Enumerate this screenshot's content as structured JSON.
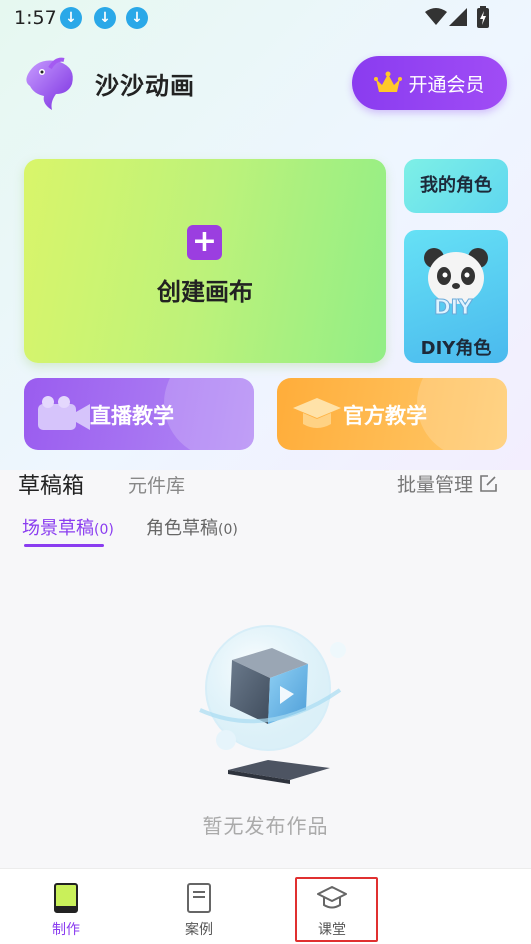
{
  "status_bar": {
    "time": "1:57",
    "notification_icons": [
      "download-icon",
      "download-icon",
      "download-icon"
    ],
    "system_icons": [
      "wifi-icon",
      "signal-icon",
      "battery-icon"
    ]
  },
  "header": {
    "app_title": "沙沙动画",
    "vip_label": "开通会员"
  },
  "cards": {
    "create_label": "创建画布",
    "my_character_label": "我的角色",
    "diy_character_label": "DIY角色",
    "live_teaching_label": "直播教学",
    "official_teaching_label": "官方教学"
  },
  "tabs": {
    "drafts": "草稿箱",
    "components": "元件库",
    "batch_manage": "批量管理"
  },
  "subtabs": {
    "scene_drafts": "场景草稿",
    "scene_count": "(0)",
    "character_drafts": "角色草稿",
    "character_count": "(0)"
  },
  "empty_state": {
    "text": "暂无发布作品"
  },
  "bottom_nav": {
    "items": [
      {
        "label": "制作",
        "icon": "phone-icon",
        "active": true
      },
      {
        "label": "案例",
        "icon": "document-icon",
        "active": false
      },
      {
        "label": "课堂",
        "icon": "graduation-cap-icon",
        "active": false
      }
    ]
  },
  "colors": {
    "accent": "#8a3cf0",
    "create_card": "#c5f27a",
    "live_card": "#a46df2",
    "official_card": "#ffb545",
    "highlight_box": "#e03030"
  }
}
